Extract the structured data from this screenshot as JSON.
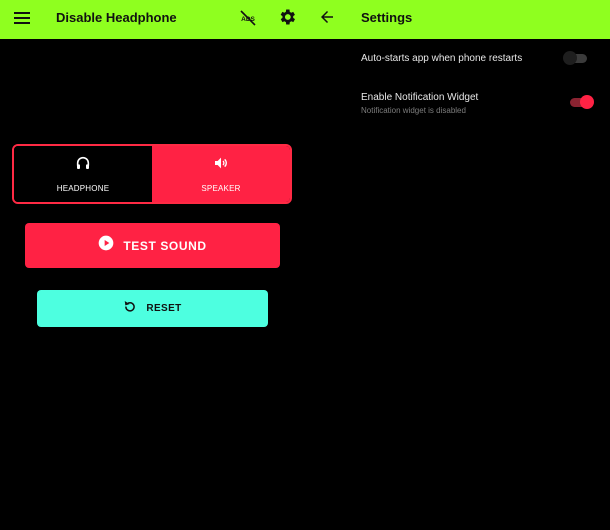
{
  "app": {
    "title": "Disable Headphone",
    "menu_icon": "hamburger-menu-icon",
    "no_ads_icon": "no-ads-icon",
    "settings_icon": "gear-icon"
  },
  "settings_panel": {
    "back_icon": "arrow-left-icon",
    "title": "Settings",
    "items": [
      {
        "label": "Auto-starts app when phone restarts",
        "enabled": false
      },
      {
        "label": "Enable Notification Widget",
        "subtitle": "Notification widget is disabled",
        "enabled": true
      }
    ]
  },
  "output_toggle": {
    "options": [
      {
        "label": "HEADPHONE",
        "icon": "headphones-icon",
        "selected": false
      },
      {
        "label": "SPEAKER",
        "icon": "speaker-icon",
        "selected": true
      }
    ]
  },
  "buttons": {
    "test_sound": {
      "label": "TEST SOUND",
      "icon": "play-circle-icon"
    },
    "reset": {
      "label": "RESET",
      "icon": "reset-icon"
    }
  },
  "colors": {
    "app_bar": "#8fff1f",
    "accent_red": "#ff2244",
    "accent_cyan": "#4dffe0",
    "background": "#000000"
  }
}
